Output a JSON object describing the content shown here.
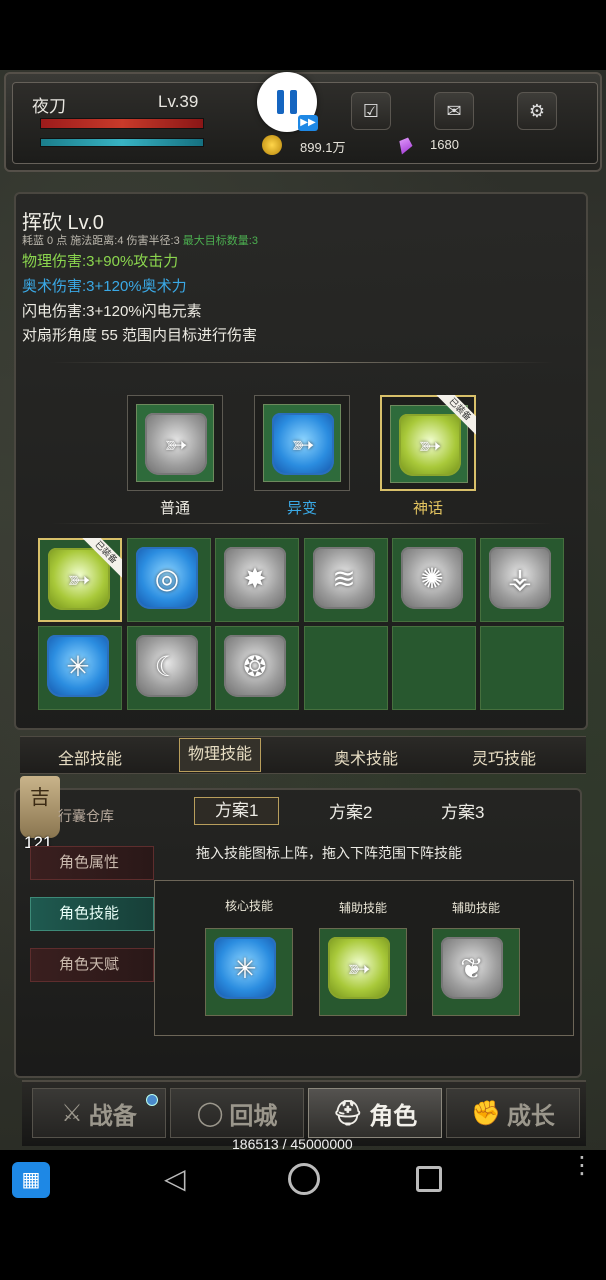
{
  "player": {
    "name": "夜刀",
    "level": "Lv.39",
    "hp_fraction": 1.0,
    "mp_fraction": 1.0
  },
  "currency": {
    "gold": "899.1万",
    "gems": "1680"
  },
  "hud_icons": {
    "pause": "pause-icon",
    "fast_forward": "fast-forward-icon",
    "quest": "checklist-icon",
    "mail": "mail-icon",
    "settings": "gear-icon"
  },
  "skill": {
    "title": "挥砍 Lv.0",
    "stats_prefix": "耗蓝 0 点     施法距离:4   伤害半径:3",
    "stats_max": "最大目标数量:3",
    "line1": "物理伤害:3+90%攻击力",
    "line2": "奥术伤害:3+120%奥术力",
    "line3": "闪电伤害:3+120%闪电元素",
    "line4": "对扇形角度 55 范围内目标进行伤害"
  },
  "rarities": [
    {
      "label": "普通",
      "color": "#eceae2"
    },
    {
      "label": "异变",
      "color": "#3aa9e6"
    },
    {
      "label": "神话",
      "color": "#e3c460",
      "badge": "已装备"
    }
  ],
  "grid_badge": "已装备",
  "tabs": [
    "全部技能",
    "物理技能",
    "奥术技能",
    "灵巧技能"
  ],
  "side_menu": {
    "ghost": "行囊仓库",
    "items": [
      "角色属性",
      "角色技能",
      "角色天赋"
    ]
  },
  "badge": {
    "symbol": "吉",
    "value": "121"
  },
  "plans": [
    "方案1",
    "方案2",
    "方案3"
  ],
  "hint": "拖入技能图标上阵，拖入下阵范围下阵技能",
  "slots": [
    "核心技能",
    "辅助技能",
    "辅助技能"
  ],
  "nav": [
    "战备",
    "回城",
    "角色",
    "成长"
  ],
  "exp": "186513 / 45000000",
  "colors": {
    "accent_gold": "#d8c06a",
    "green": "#8bd64e",
    "blue": "#3aa9e6",
    "max_target": "#4caf50"
  }
}
